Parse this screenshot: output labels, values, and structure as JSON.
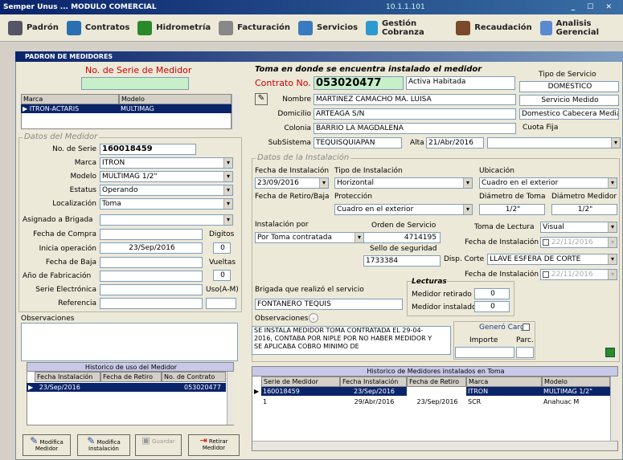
{
  "window": {
    "title": "Semper Unus ... MODULO COMERCIAL",
    "ip": "10.1.1.101",
    "controls": "_ ☐ ✕"
  },
  "toolbar": [
    {
      "label": "Padrón",
      "color": "#556"
    },
    {
      "label": "Contratos",
      "color": "#2a6fb0"
    },
    {
      "label": "Hidrometría",
      "color": "#2a8a2a"
    },
    {
      "label": "Facturación",
      "color": "#888"
    },
    {
      "label": "Servicios",
      "color": "#3a7ac0"
    },
    {
      "label": "Gestión Cobranza",
      "color": "#2a9ad0"
    },
    {
      "label": "Recaudación",
      "color": "#7a4a2a"
    },
    {
      "label": "Analisis Gerencial",
      "color": "#5a8ad0"
    }
  ],
  "panel": {
    "title": "PADRON DE MEDIDORES"
  },
  "left": {
    "serie_label": "No. de Serie de Medidor",
    "grid_headers": [
      "Marca",
      "Modelo"
    ],
    "grid_row": [
      "ITRON-ACTARIS",
      "MULTIMAG"
    ],
    "group_title": "Datos del Medidor",
    "no_serie_label": "No. de Serie",
    "no_serie": "160018459",
    "marca_label": "Marca",
    "marca": "ITRON",
    "modelo_label": "Modelo",
    "modelo": "MULTIMAG 1/2\"",
    "estatus_label": "Estatus",
    "estatus": "Operando",
    "localizacion_label": "Localización",
    "localizacion": "Toma",
    "brigada_label": "Asignado a Brigada",
    "fecha_compra_label": "Fecha de Compra",
    "digitos_label": "Digitos",
    "digitos": "0",
    "inicia_label": "Inicia operación",
    "inicia": "23/Sep/2016",
    "baja_label": "Fecha de Baja",
    "vueltas_label": "Vueltas",
    "vueltas": "0",
    "anio_label": "Año de Fabricación",
    "serie_elec_label": "Serie Electrónica",
    "uso_label": "Uso(A-M)",
    "referencia_label": "Referencia",
    "observaciones_label": "Observaciones",
    "historico_title": "Historico de uso del Medidor",
    "hist_headers": [
      "Fecha Instalación",
      "Fecha de Retiro",
      "No. de Contrato"
    ],
    "hist_row": [
      "23/Sep/2016",
      "",
      "053020477"
    ]
  },
  "buttons": [
    {
      "label": "Modifica Medidor"
    },
    {
      "label": "Modifica Instalación"
    },
    {
      "label": "Guardar"
    },
    {
      "label": "Retirar Medidor"
    }
  ],
  "toma": {
    "title": "Toma en donde se encuentra instalado el medidor",
    "contrato_label": "Contrato No.",
    "contrato": "053020477",
    "estado": "Activa Habitada",
    "nombre_label": "Nombre",
    "nombre": "MARTINEZ CAMACHO MA. LUISA",
    "domicilio_label": "Domicilio",
    "domicilio": "ARTEAGA S/N",
    "colonia_label": "Colonia",
    "colonia": "BARRIO LA MAGDALENA",
    "subsistema_label": "SubSistema",
    "subsistema": "TEQUISQUIAPAN",
    "alta_label": "Alta",
    "alta": "21/Abr/2016",
    "tipo_servicio_label": "Tipo de Servicio",
    "tipo_servicio": "DOMESTICO",
    "servicio_medido": "Servicio Medido",
    "domestico_cab": "Domestico Cabecera Media",
    "cuota_fija": "Cuota Fija"
  },
  "inst": {
    "title": "Datos de la Instalación",
    "fecha_inst_label": "Fecha de Instalación",
    "fecha_inst": "23/09/2016",
    "tipo_inst_label": "Tipo de Instalación",
    "tipo_inst": "Horizontal",
    "ubicacion_label": "Ubicación",
    "ubicacion": "Cuadro en el exterior",
    "fecha_retiro_label": "Fecha de Retiro/Baja",
    "proteccion_label": "Protección",
    "proteccion": "Cuadro en el exterior",
    "diam_toma_label": "Diámetro de Toma",
    "diam_toma": "1/2\"",
    "diam_med_label": "Diámetro Medidor",
    "diam_med": "1/2\"",
    "inst_por_label": "Instalación por",
    "inst_por": "Por Toma contratada",
    "orden_label": "Orden de Servicio",
    "orden": "4714195",
    "sello_label": "Sello de seguridad",
    "sello": "1733384",
    "toma_lectura_label": "Toma de Lectura",
    "toma_lectura": "Visual",
    "fecha_inst2_label": "Fecha de Instalación",
    "fecha_inst2": "22/11/2016",
    "disp_corte_label": "Disp. Corte",
    "disp_corte": "LLAVE ESFERA DE CORTE",
    "fecha_inst3_label": "Fecha de Instalación",
    "fecha_inst3": "22/11/2016",
    "brigada_label": "Brigada que realizó el servicio",
    "brigada": "FONTANERO TEQUIS",
    "lecturas_label": "Lecturas",
    "med_ret_label": "Medidor retirado",
    "med_ret": "0",
    "med_inst_label": "Medidor instalado",
    "med_inst": "0",
    "obs_label": "Observaciones",
    "obs": "SE INSTALA MEDIDOR TOMA CONTRATADA EL 29-04-2016, CONTABA POR NIPLE POR NO HABER MEDIDOR Y SE APLICABA COBRO MINIMO DE",
    "genero_label": "Generó Cargo",
    "importe_label": "Importe",
    "parc_label": "Parc."
  },
  "hist2": {
    "title": "Historico de Medidores instalados en Toma",
    "headers": [
      "Serie de Medidor",
      "Fecha Instalación",
      "Fecha de Retiro",
      "Marca",
      "Modelo"
    ],
    "rows": [
      [
        "160018459",
        "23/Sep/2016",
        "",
        "ITRON",
        "MULTIMAG 1/2\""
      ],
      [
        "1",
        "29/Abr/2016",
        "23/Sep/2016",
        "SCR",
        "Anahuac M"
      ]
    ]
  }
}
